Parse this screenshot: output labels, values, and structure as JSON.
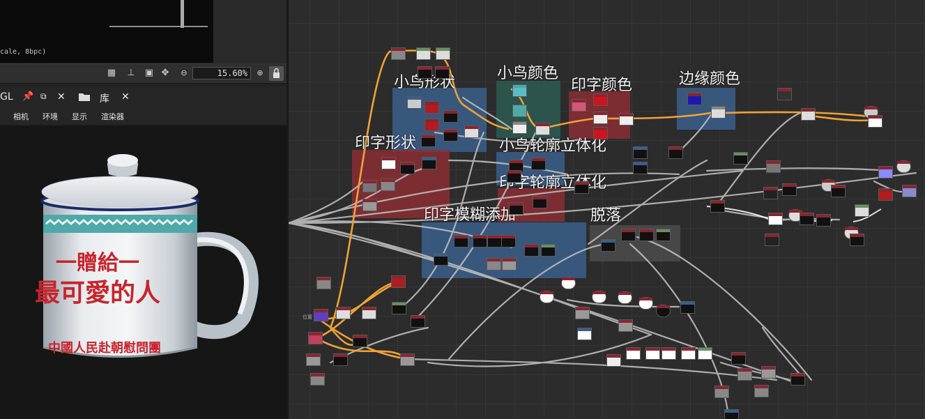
{
  "preview_2d": {
    "format_info": "cale, 8bpc)",
    "zoom_value": "15.60%"
  },
  "viewer_tabs": {
    "viewer_label": "GL",
    "library_label": "库"
  },
  "viewer_menu": [
    "相机",
    "环境",
    "显示",
    "渲染器"
  ],
  "mug_print": {
    "top_line": "一贈給一",
    "main_line": "最可愛的人",
    "bottom_line": "中國人民赴朝慰問團"
  },
  "graph": {
    "frames": [
      {
        "title": "小鸟形状"
      },
      {
        "title": "小鸟颜色"
      },
      {
        "title": "印字颜色"
      },
      {
        "title": "边缘颜色"
      },
      {
        "title": "印字形状"
      },
      {
        "title": "小鸟轮廓立体化"
      },
      {
        "title": "印字轮廓立体化"
      },
      {
        "title": "印字模糊添加"
      },
      {
        "title": "脱落"
      }
    ],
    "small_label": "位置"
  },
  "colors": {
    "frame_blue": "#3b5f8c",
    "frame_red": "#8b2e34",
    "frame_teal": "#2d5a52",
    "frame_gray": "#4a4a4a",
    "wire_orange": "#f0a236",
    "wire_gray": "#bdbdbd",
    "node_header_red": "#8b2430",
    "node_header_green": "#6b8f62",
    "mug_red": "#c8242c",
    "mug_teal": "#4ea9a8"
  },
  "icons": [
    "grid-icon",
    "fit-icon",
    "frame-icon",
    "move-icon",
    "zoom-out-icon",
    "zoom-in-icon",
    "lock-icon",
    "pin-icon",
    "maximize-icon",
    "close-icon",
    "folder-icon"
  ]
}
